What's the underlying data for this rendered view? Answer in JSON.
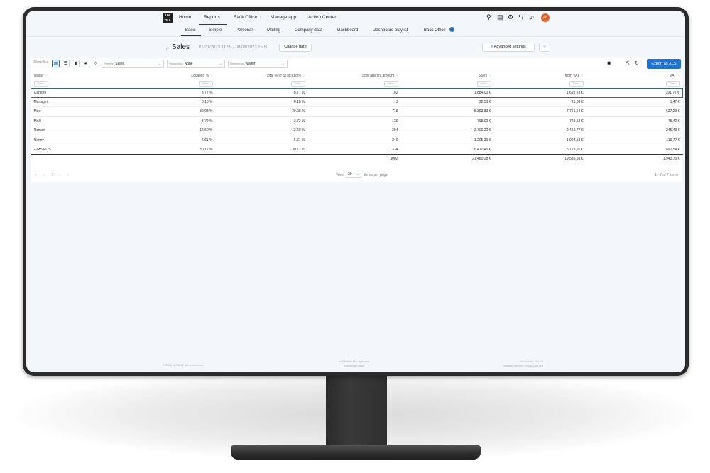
{
  "nav": {
    "logo": "UN TILL",
    "items": [
      "Home",
      "Reports",
      "Back Office",
      "Manage app",
      "Action Center"
    ],
    "avatar": "AO"
  },
  "subnav": {
    "items": [
      "Basic",
      "Simple",
      "Personal",
      "Mailing",
      "Company data",
      "Dashboard",
      "Dashboard playlist",
      "Back Office"
    ],
    "badge": "1"
  },
  "header": {
    "title": "Sales",
    "date_range": "01/01/2023 11:59 - 08/08/2023 15:50",
    "change_date": "Change date",
    "advanced_settings": "Advanced settings"
  },
  "toolbar": {
    "show_like": "Show like",
    "primary_label": "Primary:",
    "primary_value": "Sales",
    "secondary_label": "Secondary:",
    "secondary_value": "None",
    "dimension_label": "Dimension:",
    "dimension_value": "Waiter",
    "export": "Export as XLS"
  },
  "table": {
    "columns": [
      "Waiter",
      "Location %",
      "Total % of all locations",
      "Sold articles amount",
      "Sales",
      "from VAT",
      "VAT"
    ],
    "filter_placeholder": "Filter",
    "rows": [
      [
        "Karsten",
        "8.77 %",
        "8.77 %",
        "182",
        "1.884,00 €",
        "1.692,23 €",
        "191,77 €"
      ],
      [
        "Manager",
        "0.10 %",
        "0.10 %",
        "3",
        "22,50 €",
        "21,03 €",
        "1,47 €"
      ],
      [
        "Max",
        "39.08 %",
        "39.08 %",
        "719",
        "8.393,83 €",
        "7.766,54 €",
        "627,29 €"
      ],
      [
        "Molli",
        "3.72 %",
        "3.72 %",
        "130",
        "798,00 €",
        "722,58 €",
        "75,42 €"
      ],
      [
        "Roman",
        "12.60 %",
        "12.60 %",
        "394",
        "2.706,20 €",
        "2.460,77 €",
        "245,43 €"
      ],
      [
        "Ronny",
        "5.61 %",
        "5.61 %",
        "240",
        "1.205,30 €",
        "1.094,53 €",
        "110,77 €"
      ],
      [
        "Z-MS POS",
        "30.12 %",
        "30.12 %",
        "1334",
        "6.470,45 €",
        "5.778,91 €",
        "691,54 €"
      ]
    ],
    "totals": [
      "",
      "",
      "",
      "3002",
      "21.480,28 €",
      "19.536,58 €",
      "1.943,70 €"
    ]
  },
  "pagination": {
    "page": "1",
    "view_label": "View",
    "page_size": "30",
    "items_per_page": "items per page",
    "range": "1 - 7 of 7 items"
  },
  "footer": {
    "copyright": "© 2023 unTill. All rights reserved.",
    "app_name": "unTill Web Management",
    "knowledge_base": "Knowledge base",
    "ui_version": "UI version: 704.63",
    "installer_version": "Installer version: 144.6.6.38718"
  }
}
